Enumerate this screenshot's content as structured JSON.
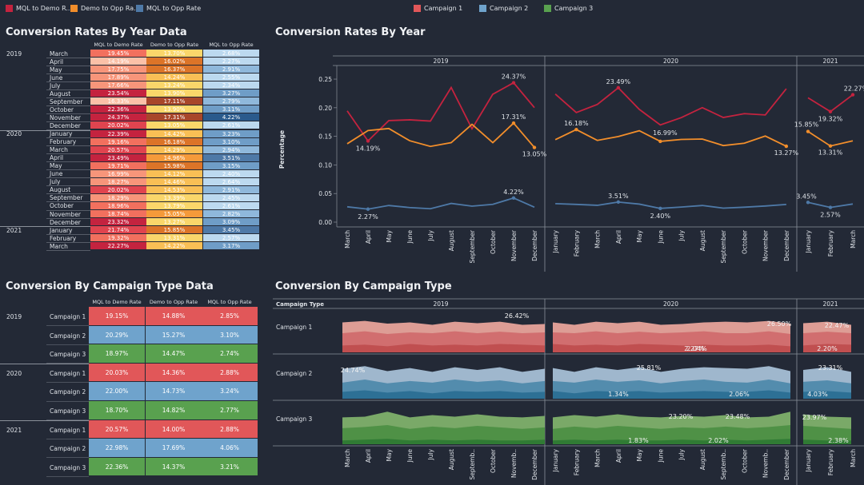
{
  "legend_top": [
    {
      "label": "MQL to Demo R..",
      "color": "#c4233f"
    },
    {
      "label": "Demo to Opp Ra..",
      "color": "#f28e2b"
    },
    {
      "label": "MQL to Opp Rate",
      "color": "#4e79a7"
    },
    {
      "label": "Campaign 1",
      "color": "#e15759"
    },
    {
      "label": "Campaign 2",
      "color": "#6fa3cc"
    },
    {
      "label": "Campaign 3",
      "color": "#59a14f"
    }
  ],
  "table1": {
    "title": "Conversion Rates By Year Data",
    "headers": [
      "MQL to Demo Rate",
      "Demo to Opp Rate",
      "MQL to Opp Rate"
    ],
    "groups": [
      {
        "year": "2019",
        "rows": [
          {
            "month": "March",
            "values": [
              "19.45%",
              "13.70%",
              "2.68%"
            ]
          },
          {
            "month": "April",
            "values": [
              "14.19%",
              "16.02%",
              "2.27%"
            ]
          },
          {
            "month": "May",
            "values": [
              "17.75%",
              "16.37%",
              "2.91%"
            ]
          },
          {
            "month": "June",
            "values": [
              "17.89%",
              "14.24%",
              "2.55%"
            ]
          },
          {
            "month": "July",
            "values": [
              "17.66%",
              "13.24%",
              "2.34%"
            ]
          },
          {
            "month": "August",
            "values": [
              "23.54%",
              "13.90%",
              "3.27%"
            ]
          },
          {
            "month": "September",
            "values": [
              "16.33%",
              "17.11%",
              "2.79%"
            ]
          },
          {
            "month": "October",
            "values": [
              "22.36%",
              "13.90%",
              "3.11%"
            ]
          },
          {
            "month": "November",
            "values": [
              "24.37%",
              "17.31%",
              "4.22%"
            ]
          },
          {
            "month": "December",
            "values": [
              "20.02%",
              "13.05%",
              "2.61%"
            ]
          }
        ]
      },
      {
        "year": "2020",
        "rows": [
          {
            "month": "January",
            "values": [
              "22.39%",
              "14.42%",
              "3.23%"
            ]
          },
          {
            "month": "February",
            "values": [
              "19.16%",
              "16.18%",
              "3.10%"
            ]
          },
          {
            "month": "March",
            "values": [
              "20.57%",
              "14.29%",
              "2.94%"
            ]
          },
          {
            "month": "April",
            "values": [
              "23.49%",
              "14.96%",
              "3.51%"
            ]
          },
          {
            "month": "May",
            "values": [
              "19.71%",
              "15.98%",
              "3.15%"
            ]
          },
          {
            "month": "June",
            "values": [
              "16.99%",
              "14.12%",
              "2.40%"
            ]
          },
          {
            "month": "July",
            "values": [
              "18.27%",
              "14.46%",
              "2.64%"
            ]
          },
          {
            "month": "August",
            "values": [
              "20.02%",
              "14.53%",
              "2.91%"
            ]
          },
          {
            "month": "September",
            "values": [
              "18.29%",
              "13.39%",
              "2.45%"
            ]
          },
          {
            "month": "October",
            "values": [
              "18.96%",
              "13.79%",
              "2.61%"
            ]
          },
          {
            "month": "November",
            "values": [
              "18.74%",
              "15.05%",
              "2.82%"
            ]
          },
          {
            "month": "December",
            "values": [
              "23.32%",
              "13.27%",
              "3.09%"
            ]
          }
        ]
      },
      {
        "year": "2021",
        "rows": [
          {
            "month": "January",
            "values": [
              "21.74%",
              "15.85%",
              "3.45%"
            ]
          },
          {
            "month": "February",
            "values": [
              "19.32%",
              "13.31%",
              "2.57%"
            ]
          },
          {
            "month": "March",
            "values": [
              "22.27%",
              "14.22%",
              "3.17%"
            ]
          }
        ]
      }
    ]
  },
  "table2": {
    "title": "Conversion By Campaign Type Data",
    "headers": [
      "MQL to Demo Rate",
      "Demo to Opp Rate",
      "MQL to Opp Rate"
    ],
    "groups": [
      {
        "year": "2019",
        "rows": [
          {
            "campaign": "Campaign 1",
            "values": [
              "19.15%",
              "14.88%",
              "2.85%"
            ]
          },
          {
            "campaign": "Campaign 2",
            "values": [
              "20.29%",
              "15.27%",
              "3.10%"
            ]
          },
          {
            "campaign": "Campaign 3",
            "values": [
              "18.97%",
              "14.47%",
              "2.74%"
            ]
          }
        ]
      },
      {
        "year": "2020",
        "rows": [
          {
            "campaign": "Campaign 1",
            "values": [
              "20.03%",
              "14.36%",
              "2.88%"
            ]
          },
          {
            "campaign": "Campaign 2",
            "values": [
              "22.00%",
              "14.73%",
              "3.24%"
            ]
          },
          {
            "campaign": "Campaign 3",
            "values": [
              "18.70%",
              "14.82%",
              "2.77%"
            ]
          }
        ]
      },
      {
        "year": "2021",
        "rows": [
          {
            "campaign": "Campaign 1",
            "values": [
              "20.57%",
              "14.00%",
              "2.88%"
            ]
          },
          {
            "campaign": "Campaign 2",
            "values": [
              "22.98%",
              "17.69%",
              "4.06%"
            ]
          },
          {
            "campaign": "Campaign 3",
            "values": [
              "22.36%",
              "14.37%",
              "3.21%"
            ]
          }
        ]
      }
    ]
  },
  "chart_data": [
    {
      "type": "line",
      "title": "Conversion Rates By Year",
      "ylabel": "Percentage",
      "ylim": [
        0,
        0.26
      ],
      "yticks": [
        "0.00",
        "0.05",
        "0.10",
        "0.15",
        "0.20",
        "0.25"
      ],
      "panes": [
        {
          "year": "2019",
          "months": [
            "March",
            "April",
            "May",
            "June",
            "July",
            "August",
            "September",
            "October",
            "November",
            "December"
          ]
        },
        {
          "year": "2020",
          "months": [
            "January",
            "February",
            "March",
            "April",
            "May",
            "June",
            "July",
            "August",
            "September",
            "October",
            "November",
            "December"
          ]
        },
        {
          "year": "2021",
          "months": [
            "January",
            "February",
            "March"
          ]
        }
      ],
      "series": [
        {
          "name": "MQL to Demo R..",
          "color": "#c4233f",
          "values": [
            [
              0.1945,
              0.1419,
              0.1775,
              0.1789,
              0.1766,
              0.2354,
              0.1633,
              0.2236,
              0.2437,
              0.2002
            ],
            [
              0.2239,
              0.1916,
              0.2057,
              0.2349,
              0.1971,
              0.1699,
              0.1827,
              0.2002,
              0.1829,
              0.1896,
              0.1874,
              0.2332
            ],
            [
              0.2174,
              0.1932,
              0.2227
            ]
          ]
        },
        {
          "name": "Demo to Opp Ra..",
          "color": "#f28e2b",
          "values": [
            [
              0.137,
              0.1602,
              0.1637,
              0.1424,
              0.1324,
              0.139,
              0.1711,
              0.139,
              0.1731,
              0.1305
            ],
            [
              0.1442,
              0.1618,
              0.1429,
              0.1496,
              0.1598,
              0.1412,
              0.1446,
              0.1453,
              0.1339,
              0.1379,
              0.1505,
              0.1327
            ],
            [
              0.1585,
              0.1331,
              0.1422
            ]
          ]
        },
        {
          "name": "MQL to Opp Rate",
          "color": "#4e79a7",
          "values": [
            [
              0.0268,
              0.0227,
              0.0291,
              0.0255,
              0.0234,
              0.0327,
              0.0279,
              0.0311,
              0.0422,
              0.0261
            ],
            [
              0.0323,
              0.031,
              0.0294,
              0.0351,
              0.0315,
              0.024,
              0.0264,
              0.0291,
              0.0245,
              0.0261,
              0.0282,
              0.0309
            ],
            [
              0.0345,
              0.0257,
              0.0317
            ]
          ]
        }
      ],
      "labels": [
        {
          "pane": 0,
          "i": 1,
          "s": 0,
          "text": "14.19%"
        },
        {
          "pane": 0,
          "i": 8,
          "s": 0,
          "text": "24.37%"
        },
        {
          "pane": 0,
          "i": 8,
          "s": 1,
          "text": "17.31%"
        },
        {
          "pane": 0,
          "i": 9,
          "s": 1,
          "text": "13.05%"
        },
        {
          "pane": 0,
          "i": 1,
          "s": 2,
          "text": "2.27%"
        },
        {
          "pane": 0,
          "i": 8,
          "s": 2,
          "text": "4.22%"
        },
        {
          "pane": 1,
          "i": 3,
          "s": 0,
          "text": "23.49%"
        },
        {
          "pane": 1,
          "i": 1,
          "s": 1,
          "text": "16.18%"
        },
        {
          "pane": 1,
          "i": 5,
          "s": 1,
          "text": "16.99%"
        },
        {
          "pane": 1,
          "i": 11,
          "s": 1,
          "text": "13.27%"
        },
        {
          "pane": 1,
          "i": 3,
          "s": 2,
          "text": "3.51%"
        },
        {
          "pane": 1,
          "i": 5,
          "s": 2,
          "text": "2.40%"
        },
        {
          "pane": 2,
          "i": 1,
          "s": 0,
          "text": "19.32%"
        },
        {
          "pane": 2,
          "i": 2,
          "s": 0,
          "text": "22.27%"
        },
        {
          "pane": 2,
          "i": 0,
          "s": 1,
          "text": "15.85%"
        },
        {
          "pane": 2,
          "i": 1,
          "s": 1,
          "text": "13.31%"
        },
        {
          "pane": 2,
          "i": 0,
          "s": 2,
          "text": "3.45%"
        },
        {
          "pane": 2,
          "i": 1,
          "s": 2,
          "text": "2.57%"
        }
      ]
    },
    {
      "type": "area",
      "title": "Conversion By Campaign Type",
      "row_header": "Campaign Type",
      "rows": [
        {
          "name": "Campaign 1",
          "colors": [
            "#bf4d4e",
            "#d06c6d",
            "#e8a39b"
          ]
        },
        {
          "name": "Campaign 2",
          "colors": [
            "#2b6f93",
            "#4f89ab",
            "#a7bfd6"
          ]
        },
        {
          "name": "Campaign 3",
          "colors": [
            "#2e7a34",
            "#4d8f44",
            "#7fb06c"
          ]
        }
      ],
      "panes": [
        {
          "year": "2019",
          "months": [
            "March",
            "April",
            "May",
            "June",
            "July",
            "August",
            "Septemb..",
            "October",
            "Novemb..",
            "December"
          ]
        },
        {
          "year": "2020",
          "months": [
            "January",
            "February",
            "March",
            "April",
            "May",
            "June",
            "July",
            "August",
            "Septemb..",
            "October",
            "Novemb..",
            "December"
          ]
        },
        {
          "year": "2021",
          "months": [
            "January",
            "February",
            "March"
          ]
        }
      ],
      "labels": [
        {
          "row": 0,
          "pane": 0,
          "text": "26.42%"
        },
        {
          "row": 0,
          "pane": 0,
          "text": "2.04%"
        },
        {
          "row": 0,
          "pane": 1,
          "text": "26.50%"
        },
        {
          "row": 0,
          "pane": 1,
          "text": "2.27%"
        },
        {
          "row": 0,
          "pane": 2,
          "text": "22.47%"
        },
        {
          "row": 0,
          "pane": 2,
          "text": "2.20%"
        },
        {
          "row": 1,
          "pane": 0,
          "text": "24.74%"
        },
        {
          "row": 1,
          "pane": 0,
          "text": "2.06%"
        },
        {
          "row": 1,
          "pane": 1,
          "text": "25.81%"
        },
        {
          "row": 1,
          "pane": 1,
          "text": "1.34%"
        },
        {
          "row": 1,
          "pane": 2,
          "text": "23.31%"
        },
        {
          "row": 1,
          "pane": 2,
          "text": "4.03%"
        },
        {
          "row": 2,
          "pane": 0,
          "text": "23.48%"
        },
        {
          "row": 2,
          "pane": 0,
          "text": "2.02%"
        },
        {
          "row": 2,
          "pane": 1,
          "text": "23.20%"
        },
        {
          "row": 2,
          "pane": 1,
          "text": "1.83%"
        },
        {
          "row": 2,
          "pane": 2,
          "text": "23.97%"
        },
        {
          "row": 2,
          "pane": 2,
          "text": "2.38%"
        }
      ]
    }
  ]
}
